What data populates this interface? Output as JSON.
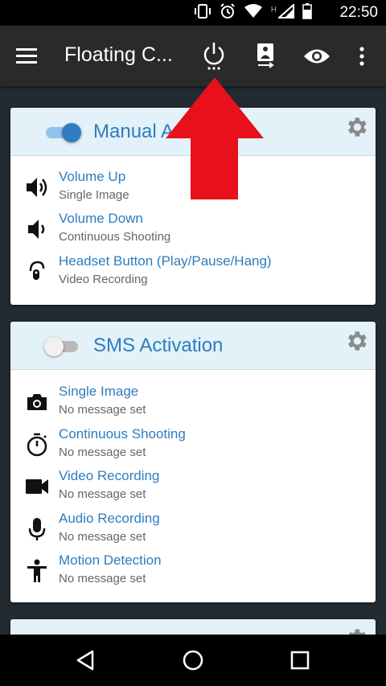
{
  "status_bar": {
    "time": "22:50",
    "icons": [
      "vibrate-icon",
      "alarm-icon",
      "wifi-icon",
      "signal-icon",
      "battery-icon"
    ],
    "network_label": "H"
  },
  "app_bar": {
    "title": "Floating C...",
    "actions": [
      "power-icon",
      "camera-switch-icon",
      "eye-icon",
      "more-vert-icon"
    ]
  },
  "cards": {
    "manual": {
      "title": "Manual Activation",
      "enabled": true,
      "items": [
        {
          "title": "Volume Up",
          "subtitle": "Single Image",
          "icon": "volume-up-icon"
        },
        {
          "title": "Volume Down",
          "subtitle": "Continuous Shooting",
          "icon": "volume-down-icon"
        },
        {
          "title": "Headset Button (Play/Pause/Hang)",
          "subtitle": "Video Recording",
          "icon": "headset-icon"
        }
      ]
    },
    "sms": {
      "title": "SMS Activation",
      "enabled": false,
      "items": [
        {
          "title": "Single Image",
          "subtitle": "No message set",
          "icon": "camera-icon"
        },
        {
          "title": "Continuous Shooting",
          "subtitle": "No message set",
          "icon": "timer-icon"
        },
        {
          "title": "Video Recording",
          "subtitle": "No message set",
          "icon": "videocam-icon"
        },
        {
          "title": "Audio Recording",
          "subtitle": "No message set",
          "icon": "mic-icon"
        },
        {
          "title": "Motion Detection",
          "subtitle": "No message set",
          "icon": "person-icon"
        }
      ]
    }
  },
  "colors": {
    "accent": "#2d7dbf",
    "card_header": "#e3f1f8",
    "background": "#222a32",
    "arrow": "#e8101a"
  }
}
